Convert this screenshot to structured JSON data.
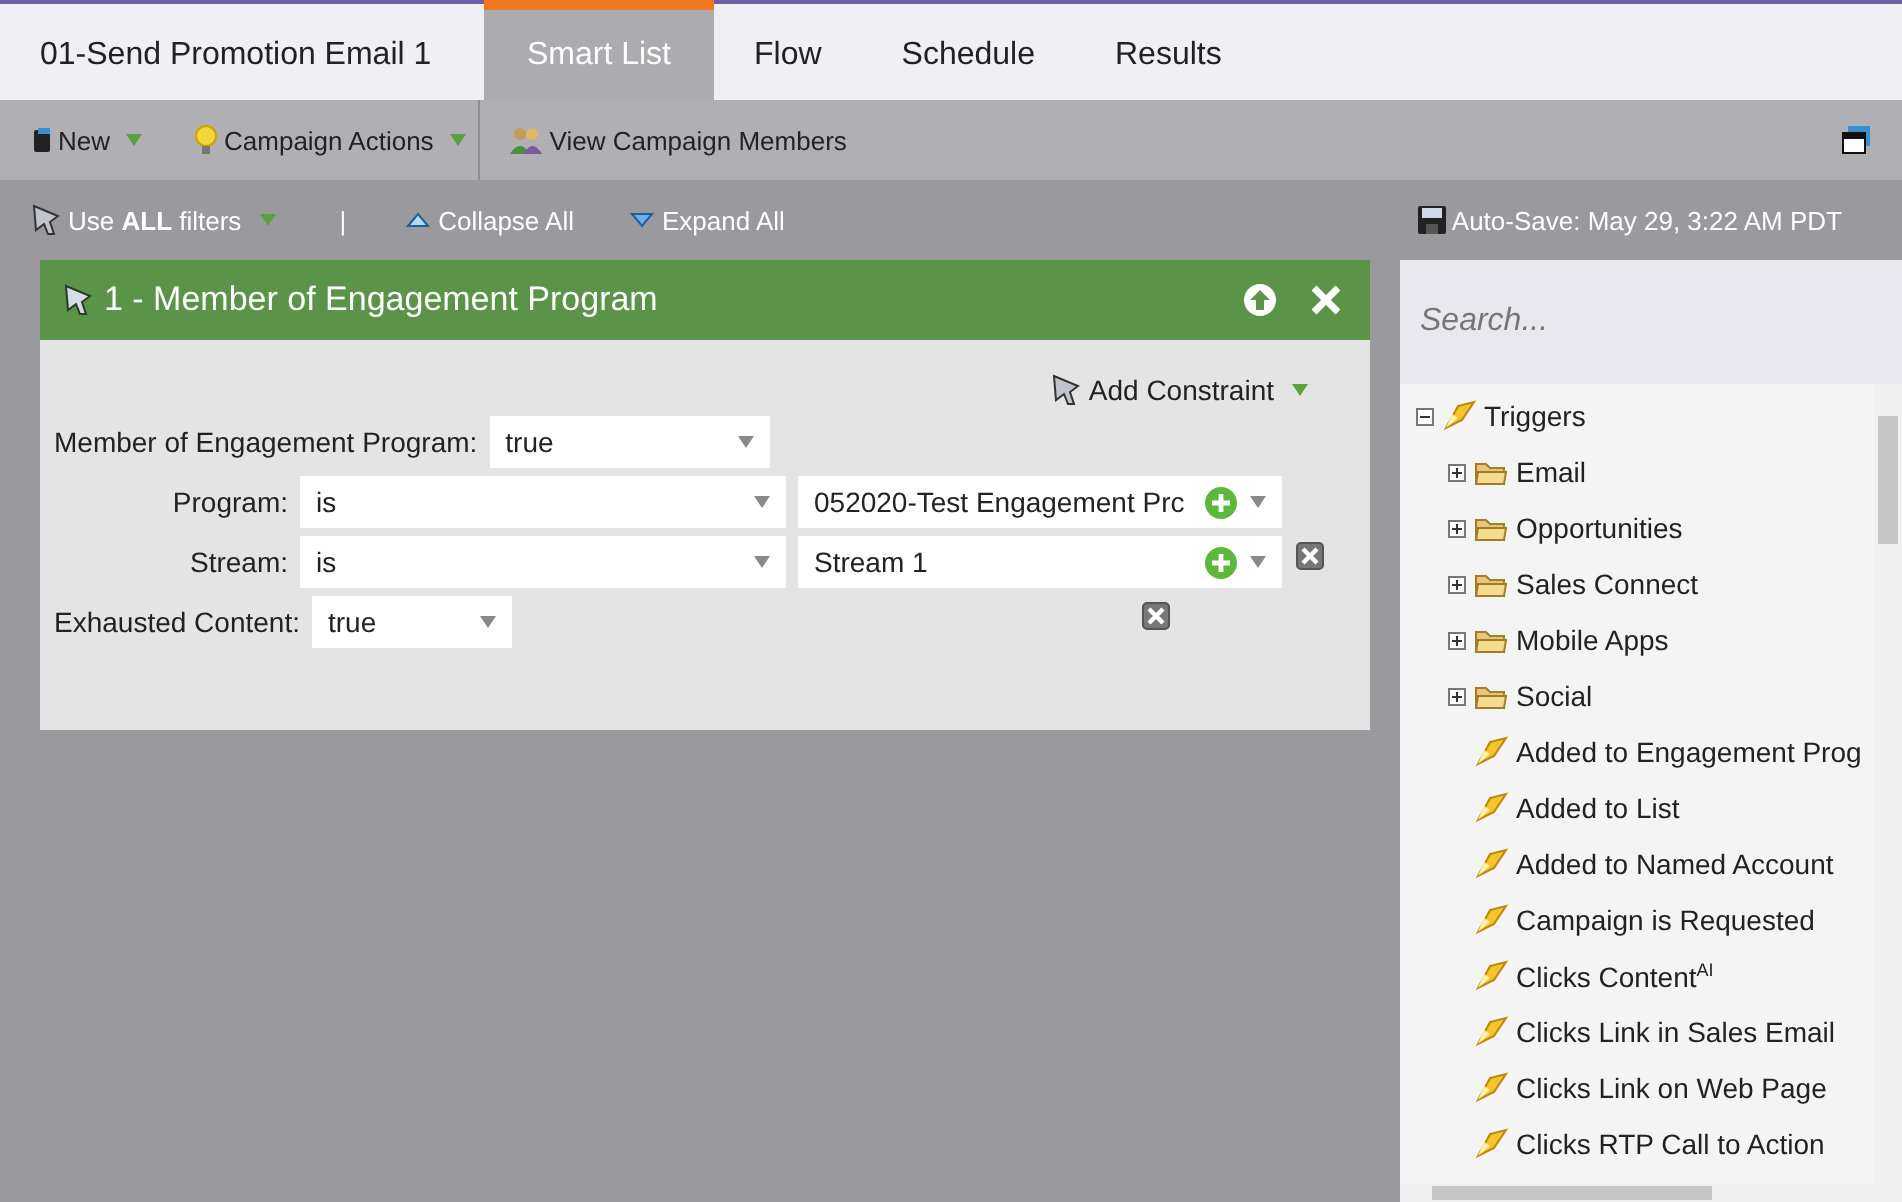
{
  "campaign_title": "01-Send Promotion Email 1",
  "tabs": [
    {
      "label": "Smart List",
      "selected": true
    },
    {
      "label": "Flow",
      "selected": false
    },
    {
      "label": "Schedule",
      "selected": false
    },
    {
      "label": "Results",
      "selected": false
    }
  ],
  "toolbar": [
    {
      "label": "New",
      "kind": "book",
      "dropdown": true
    },
    {
      "label": "Campaign Actions",
      "kind": "bulb",
      "dropdown": true
    },
    {
      "label": "View Campaign Members",
      "kind": "people",
      "dropdown": false
    }
  ],
  "filter_bar": {
    "logic": "Use **ALL** filters",
    "separator": "|",
    "collapse": "Collapse All",
    "expand": "Expand All",
    "autosave": "Auto-Save: May 29, 3:22 AM PDT"
  },
  "filter": {
    "title": "1 - Member of Engagement Program",
    "add_constraint": "Add Constraint",
    "rows": [
      {
        "kind": "single",
        "label": "Member of Engagement Program:",
        "value": "true",
        "removable": false
      },
      {
        "kind": "pair",
        "label": "Program:",
        "operator": "is",
        "value": "052020-Test Engagement Prc",
        "removable": false
      },
      {
        "kind": "pair",
        "label": "Stream:",
        "operator": "is",
        "value": "Stream 1",
        "removable": true
      },
      {
        "kind": "single",
        "label": "Exhausted Content:",
        "value": "true",
        "removable": true
      }
    ]
  },
  "sidebar": {
    "search": {
      "placeholder": "Search..."
    },
    "tree": [
      {
        "label": "Triggers",
        "kind": "group",
        "expanded": true,
        "children": [
          {
            "label": "Email",
            "kind": "folder",
            "expanded": false
          },
          {
            "label": "Opportunities",
            "kind": "folder",
            "expanded": false
          },
          {
            "label": "Sales Connect",
            "kind": "folder",
            "expanded": false
          },
          {
            "label": "Mobile Apps",
            "kind": "folder",
            "expanded": false
          },
          {
            "label": "Social",
            "kind": "folder",
            "expanded": false
          },
          {
            "label": "Added to Engagement Prog",
            "kind": "trigger"
          },
          {
            "label": "Added to List",
            "kind": "trigger"
          },
          {
            "label": "Added to Named Account",
            "kind": "trigger"
          },
          {
            "label": "Campaign is Requested",
            "kind": "trigger"
          },
          {
            "label": "Clicks Content$^{AI}$",
            "kind": "trigger"
          },
          {
            "label": "Clicks Link in Sales Email",
            "kind": "trigger"
          },
          {
            "label": "Clicks Link on Web Page",
            "kind": "trigger"
          },
          {
            "label": "Clicks RTP Call to Action",
            "kind": "trigger"
          }
        ]
      }
    ]
  }
}
